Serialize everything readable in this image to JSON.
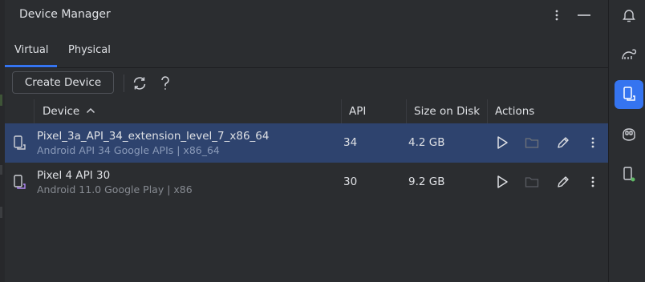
{
  "panel": {
    "title": "Device Manager",
    "header_icons": [
      "more-vertical-icon",
      "minimize-icon"
    ]
  },
  "tabs": [
    {
      "label": "Virtual",
      "active": true
    },
    {
      "label": "Physical",
      "active": false
    }
  ],
  "toolbar": {
    "create_label": "Create Device",
    "icons": [
      "refresh-icon",
      "help-icon"
    ]
  },
  "table": {
    "columns": [
      "Device",
      "API",
      "Size on Disk",
      "Actions"
    ],
    "sort": {
      "column": "Device",
      "direction": "ascending"
    },
    "rows": [
      {
        "name": "Pixel_3a_API_34_extension_level_7_x86_64",
        "subtitle": "Android API 34 Google APIs | x86_64",
        "api": "34",
        "size": "4.2 GB",
        "selected": true
      },
      {
        "name": "Pixel 4 API 30",
        "subtitle": "Android 11.0 Google Play | x86",
        "api": "30",
        "size": "9.2 GB",
        "selected": false
      }
    ],
    "row_actions": [
      "play-icon",
      "folder-icon",
      "edit-icon",
      "more-vertical-icon"
    ]
  },
  "right_stripe": {
    "icons": [
      "notifications-icon",
      "gradle-icon",
      "device-manager-icon",
      "copilot-icon",
      "running-devices-icon"
    ],
    "active": "device-manager-icon"
  },
  "colors": {
    "background": "#2b2d30",
    "accent": "#3574f0",
    "selected_row": "#2e436e",
    "text": "#dfe1e5",
    "muted_text": "#868a91"
  }
}
